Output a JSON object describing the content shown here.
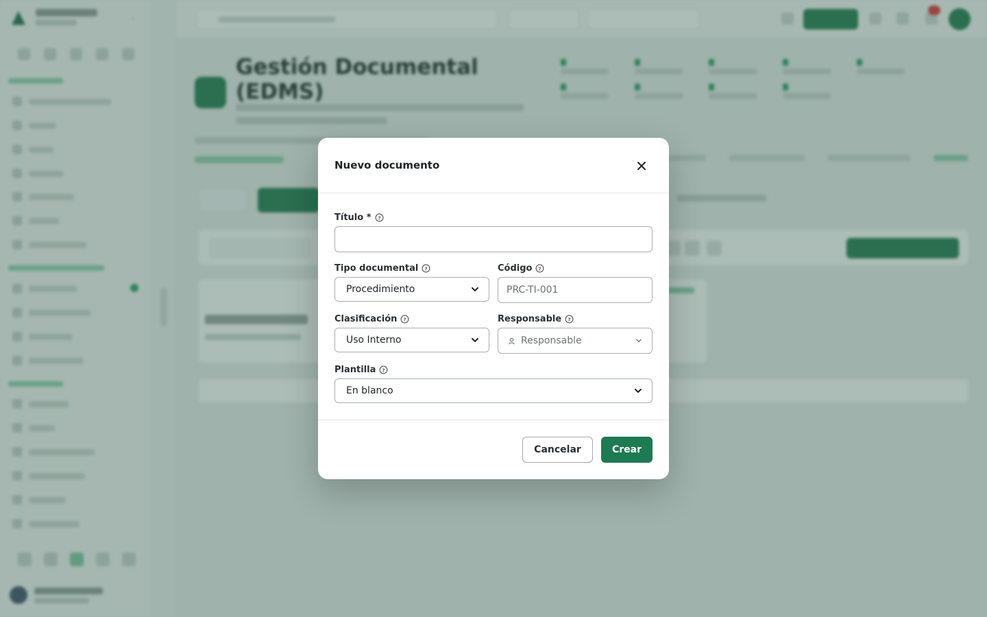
{
  "background": {
    "hero_title": "Gestión Documental (EDMS)"
  },
  "modal": {
    "title": "Nuevo documento",
    "fields": {
      "titulo": {
        "label": "Título *",
        "value": "",
        "placeholder": ""
      },
      "tipo": {
        "label": "Tipo documental",
        "selected": "Procedimiento"
      },
      "codigo": {
        "label": "Código",
        "value": "",
        "placeholder": "PRC-TI-001"
      },
      "clasificacion": {
        "label": "Clasificación",
        "selected": "Uso Interno"
      },
      "responsable": {
        "label": "Responsable",
        "placeholder": "Responsable"
      },
      "plantilla": {
        "label": "Plantilla",
        "selected": "En blanco"
      }
    },
    "buttons": {
      "cancel": "Cancelar",
      "create": "Crear"
    }
  },
  "icons": {
    "close": "close-icon",
    "help": "help-circle-icon",
    "user": "user-icon",
    "select_arrow": "chevron-down-icon"
  },
  "colors": {
    "primary": "#1e7a52",
    "overlay": "#3a6054",
    "border": "#a9adb2"
  }
}
